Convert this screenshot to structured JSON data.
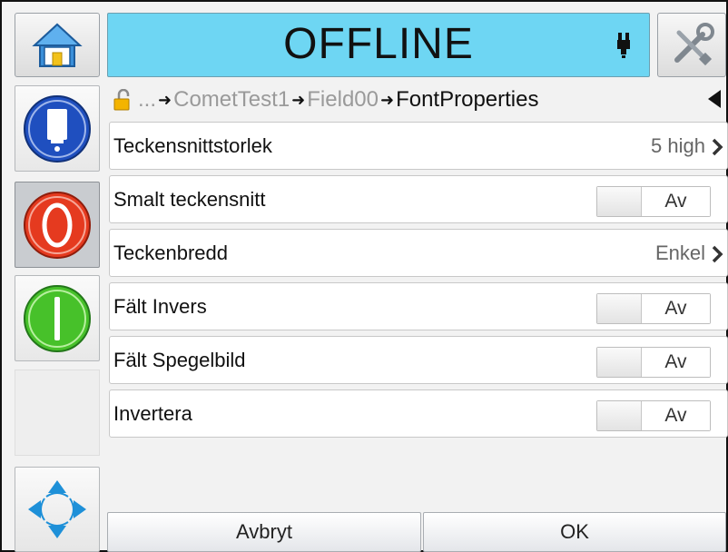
{
  "header": {
    "status": "OFFLINE",
    "home_icon": "home-icon",
    "ink_icon": "ink-cartridge-icon",
    "tools_icon": "tools-icon"
  },
  "sidebar": {
    "buttons": [
      {
        "icon": "print-head-icon"
      },
      {
        "icon": "stop-icon"
      },
      {
        "icon": "start-icon"
      }
    ],
    "nav_icon": "navigation-arrows-icon"
  },
  "breadcrumb": {
    "ellipsis": "...",
    "items": [
      "CometTest1",
      "Field00",
      "FontProperties"
    ],
    "lock_icon": "unlocked-padlock-icon",
    "back_icon": "back-arrow-icon"
  },
  "settings": [
    {
      "label": "Teckensnittstorlek",
      "value": "5 high"
    },
    {
      "label": "Smalt teckensnitt",
      "toggle": "Av"
    },
    {
      "label": "Teckenbredd",
      "value": "Enkel"
    },
    {
      "label": "Fält Invers",
      "toggle": "Av"
    },
    {
      "label": "Fält Spegelbild",
      "toggle": "Av"
    },
    {
      "label": "Invertera",
      "toggle": "Av"
    }
  ],
  "footer": {
    "cancel_label": "Avbryt",
    "ok_label": "OK"
  },
  "colors": {
    "status_bg": "#6ed6f3",
    "stop": "#e53a1f",
    "start": "#47c12a",
    "print_head": "#1f4fbf",
    "nav_arrows": "#1e90d8"
  }
}
